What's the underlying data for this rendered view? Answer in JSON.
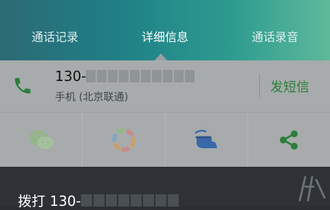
{
  "tabs": [
    {
      "label": "通话记录"
    },
    {
      "label": "详细信息"
    },
    {
      "label": "通话录音"
    }
  ],
  "contact": {
    "number_prefix": "130-",
    "carrier": "手机 (北京联通)",
    "sms_label": "发短信"
  },
  "actions": [
    {
      "icon": "wechat-icon"
    },
    {
      "icon": "color-wheel-icon"
    },
    {
      "icon": "hand-swipe-icon"
    },
    {
      "icon": "share-icon"
    }
  ],
  "dial": {
    "label": "拨打 130-"
  },
  "colors": {
    "accent_green": "#2b7f3a",
    "header_start": "#2c6a74",
    "header_end": "#5eb99a"
  }
}
